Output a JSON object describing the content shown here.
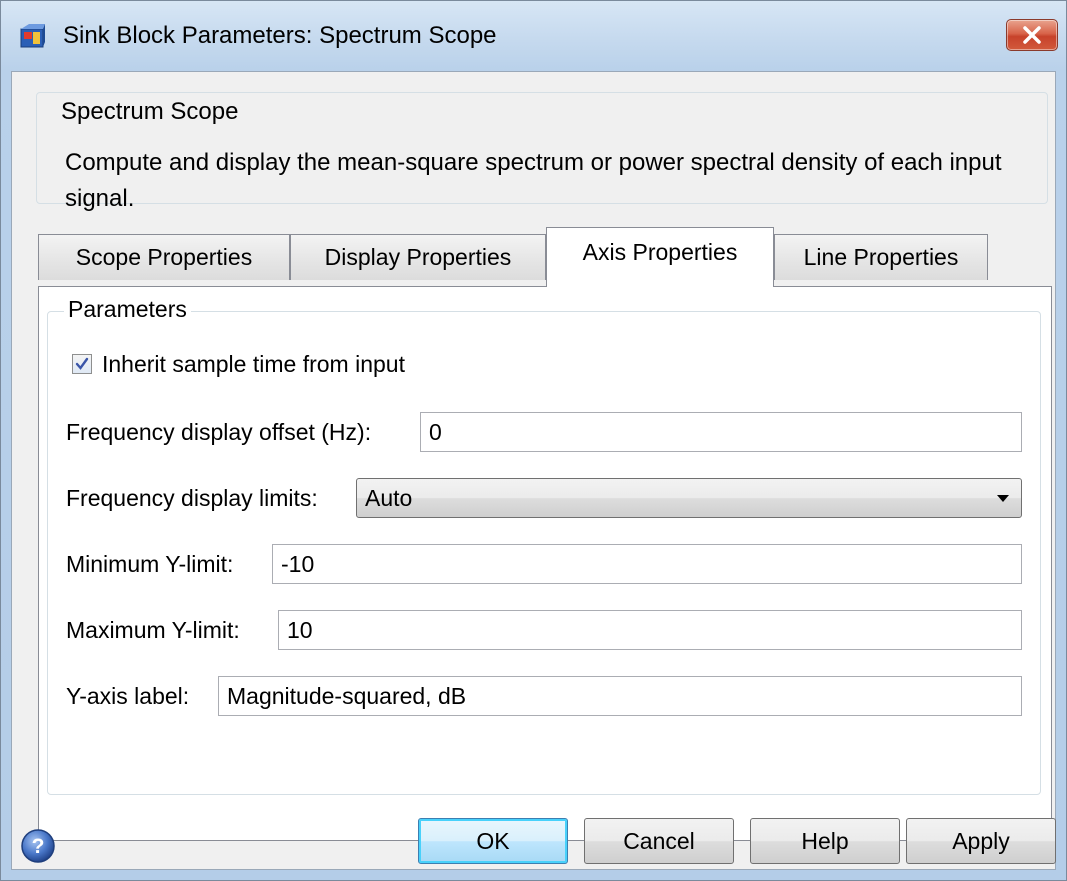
{
  "window": {
    "title": "Sink Block Parameters: Spectrum Scope",
    "close_label": "✕"
  },
  "description": {
    "legend": "Spectrum Scope",
    "text": "Compute and display the mean-square spectrum or power spectral density of each input signal."
  },
  "tabs": [
    {
      "label": "Scope Properties",
      "active": false
    },
    {
      "label": "Display Properties",
      "active": false
    },
    {
      "label": "Axis Properties",
      "active": true
    },
    {
      "label": "Line Properties",
      "active": false
    }
  ],
  "parameters": {
    "legend": "Parameters",
    "inherit_sample_time": {
      "label": "Inherit sample time from input",
      "checked": true
    },
    "frequency_offset": {
      "label": "Frequency display offset (Hz):",
      "value": "0"
    },
    "frequency_limits": {
      "label": "Frequency display limits:",
      "value": "Auto"
    },
    "min_y_limit": {
      "label": "Minimum Y-limit:",
      "value": "-10"
    },
    "max_y_limit": {
      "label": "Maximum Y-limit:",
      "value": "10"
    },
    "y_axis_label": {
      "label": "Y-axis label:",
      "value": "Magnitude-squared, dB"
    }
  },
  "buttons": {
    "ok": "OK",
    "cancel": "Cancel",
    "help": "Help",
    "apply": "Apply"
  },
  "icons": {
    "title": "simulink-block-icon",
    "help": "help-question-icon",
    "close": "close-icon"
  },
  "colors": {
    "close_button": "#c7422b",
    "default_button_border": "#3c7fb1"
  }
}
